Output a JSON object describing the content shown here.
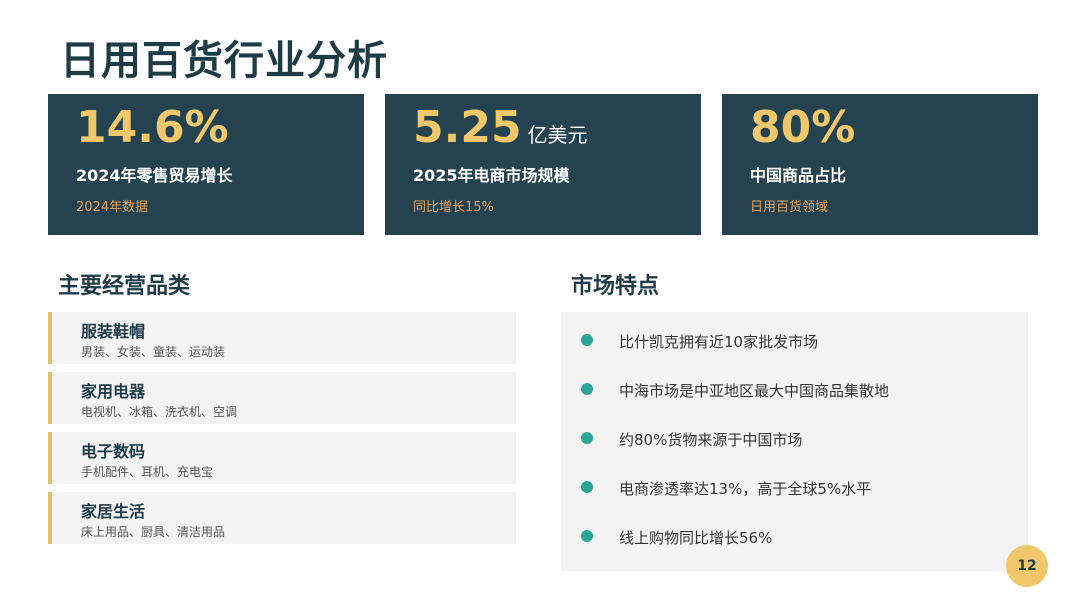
{
  "page": {
    "title": "日用百货行业分析",
    "page_number": "12"
  },
  "stats": [
    {
      "value": "14.6%",
      "unit": "",
      "label": "2024年零售贸易增长",
      "sub": "2024年数据"
    },
    {
      "value": "5.25",
      "unit": "亿美元",
      "label": "2025年电商市场规模",
      "sub": "同比增长15%"
    },
    {
      "value": "80%",
      "unit": "",
      "label": "中国商品占比",
      "sub": "日用百货领域"
    }
  ],
  "categories": {
    "heading": "主要经营品类",
    "items": [
      {
        "name": "服装鞋帽",
        "desc": "男装、女装、童装、运动装"
      },
      {
        "name": "家用电器",
        "desc": "电视机、冰箱、洗衣机、空调"
      },
      {
        "name": "电子数码",
        "desc": "手机配件、耳机、充电宝"
      },
      {
        "name": "家居生活",
        "desc": "床上用品、厨具、清洁用品"
      }
    ]
  },
  "features": {
    "heading": "市场特点",
    "items": [
      "比什凯克拥有近10家批发市场",
      "中海市场是中亚地区最大中国商品集散地",
      "约80%货物来源于中国市场",
      "电商渗透率达13%，高于全球5%水平",
      "线上购物同比增长56%"
    ]
  },
  "colors": {
    "card_bg": "#24424f",
    "accent_gold": "#f0c86b",
    "accent_orange": "#e9a35a",
    "bullet_teal": "#2aa597"
  }
}
